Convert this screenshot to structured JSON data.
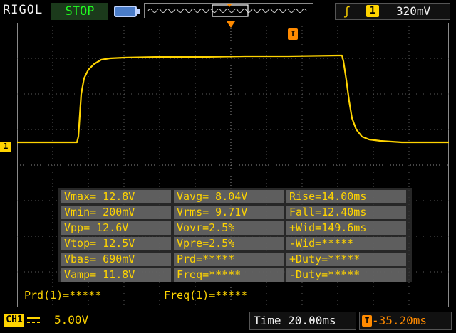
{
  "header": {
    "brand": "RIGOL",
    "run_state": "STOP",
    "trigger": {
      "edge_icon": "rising-edge-icon",
      "channel": "1",
      "level": "320mV"
    }
  },
  "markers": {
    "channel_marker": "1",
    "trigger_position_marker": "T"
  },
  "measurements": [
    [
      "Vmax= 12.8V",
      "Vavg= 8.04V",
      "Rise=14.00ms"
    ],
    [
      "Vmin= 200mV",
      "Vrms= 9.71V",
      "Fall=12.40ms"
    ],
    [
      "Vpp= 12.6V",
      "Vovr=2.5%",
      "+Wid=149.6ms"
    ],
    [
      "Vtop= 12.5V",
      "Vpre=2.5%",
      "-Wid=*****"
    ],
    [
      "Vbas= 690mV",
      "Prd=*****",
      "+Duty=*****"
    ],
    [
      "Vamp= 11.8V",
      "Freq=*****",
      "-Duty=*****"
    ]
  ],
  "counters": {
    "period": "Prd(1)=*****",
    "frequency": "Freq(1)=*****"
  },
  "footer": {
    "channel": "CH1",
    "volts_per_div": "5.00V",
    "time_base": "Time 20.00ms",
    "trigger_offset": "-35.20ms"
  },
  "colors": {
    "trace": "#ffd400",
    "trigger": "#ff8a00",
    "run_state": "#20ff20"
  }
}
